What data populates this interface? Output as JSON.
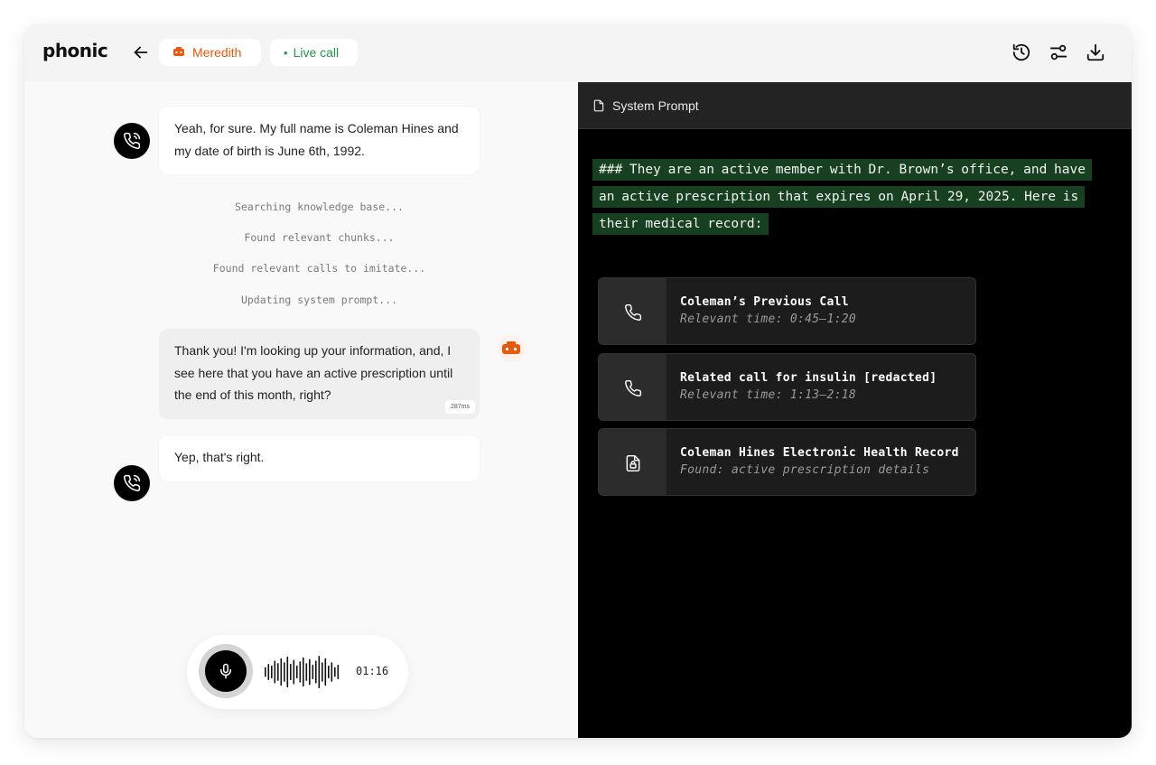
{
  "header": {
    "logo": "phonic",
    "agent_name": "Meredith",
    "live_label": "Live call",
    "icons": [
      "back-arrow-icon",
      "history-icon",
      "settings-sliders-icon",
      "download-icon"
    ],
    "colors": {
      "agent": "#e8590c",
      "live": "#1e9a4a"
    }
  },
  "conversation": {
    "messages": [
      {
        "role": "user",
        "text": "Yeah, for sure. My full name is Coleman Hines and my date of birth is June 6th, 1992."
      },
      {
        "role": "agent",
        "text": "Thank you! I'm looking up your information, and, I see here that you have an active prescription until the end of this month, right?",
        "latency": "287ms"
      },
      {
        "role": "user",
        "text": "Yep, that's right."
      }
    ],
    "status_lines": [
      "Searching knowledge base...",
      "Found relevant chunks...",
      "Found relevant calls to imitate...",
      "Updating system prompt..."
    ]
  },
  "voice": {
    "timer": "01:16",
    "wave_levels": [
      0.3,
      0.5,
      0.4,
      0.7,
      0.55,
      0.85,
      0.6,
      0.95,
      0.5,
      0.75,
      0.4,
      0.65,
      0.9,
      0.55,
      0.8,
      0.45,
      0.7,
      1.0,
      0.6,
      0.85,
      0.4,
      0.6,
      0.3,
      0.45
    ]
  },
  "system_prompt": {
    "title": "System Prompt",
    "text": "### They are an active member with Dr. Brown’s office, and have an active prescription that expires on April 29, 2025. Here is their medical record:",
    "highlight_color": "#16401f",
    "cards": [
      {
        "icon": "phone-icon",
        "title": "Coleman’s Previous Call",
        "subtitle": "Relevant time: 0:45–1:20"
      },
      {
        "icon": "phone-icon",
        "title": "Related call for insulin [redacted]",
        "subtitle": "Relevant time: 1:13–2:18"
      },
      {
        "icon": "locked-document-icon",
        "title": "Coleman Hines Electronic Health Record",
        "subtitle": "Found: active prescription details"
      }
    ]
  }
}
